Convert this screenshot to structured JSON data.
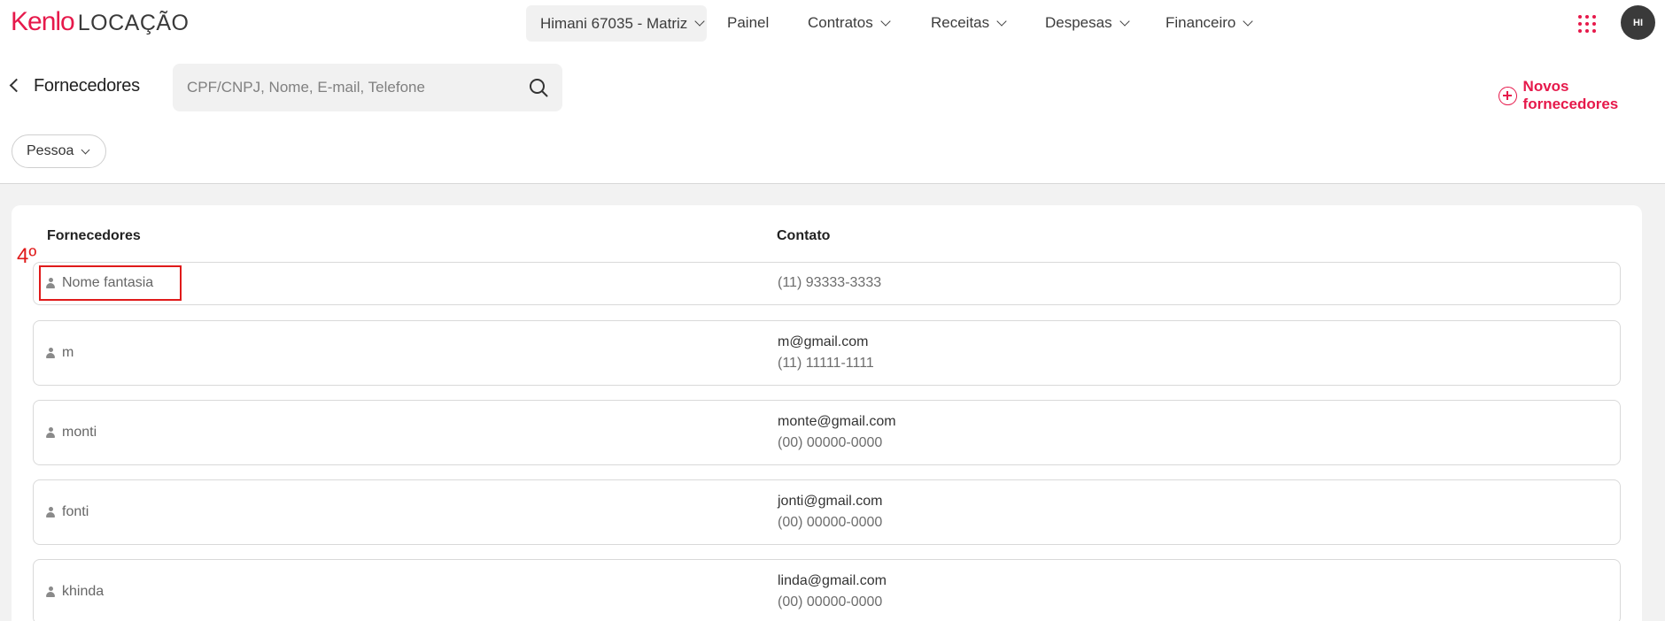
{
  "header": {
    "logo_brand": "Kenlo",
    "logo_product": "LOCAÇÃO",
    "company_select": "Himani 67035 - Matriz",
    "nav": [
      "Painel",
      "Contratos",
      "Receitas",
      "Despesas",
      "Financeiro"
    ],
    "avatar_initials": "HI",
    "apps_icon": "grid-dots-icon"
  },
  "page": {
    "title": "Fornecedores",
    "search_placeholder": "CPF/CNPJ, Nome, E-mail, Telefone",
    "new_button_label": "Novos fornecedores",
    "filter_label": "Pessoa"
  },
  "table": {
    "columns": [
      "Fornecedores",
      "Contato"
    ],
    "rows": [
      {
        "name": "Nome fantasia",
        "email": "",
        "phone": "(11) 93333-3333"
      },
      {
        "name": "m",
        "email": "m@gmail.com",
        "phone": "(11) 11111-1111"
      },
      {
        "name": "monti",
        "email": "monte@gmail.com",
        "phone": "(00) 00000-0000"
      },
      {
        "name": "fonti",
        "email": "jonti@gmail.com",
        "phone": "(00) 00000-0000"
      },
      {
        "name": "khinda",
        "email": "linda@gmail.com",
        "phone": "(00) 00000-0000"
      }
    ]
  },
  "annotation": {
    "label": "4º"
  },
  "colors": {
    "accent": "#e6194b",
    "annotation": "#e01a1a",
    "content_bg": "#f2f2f2"
  }
}
